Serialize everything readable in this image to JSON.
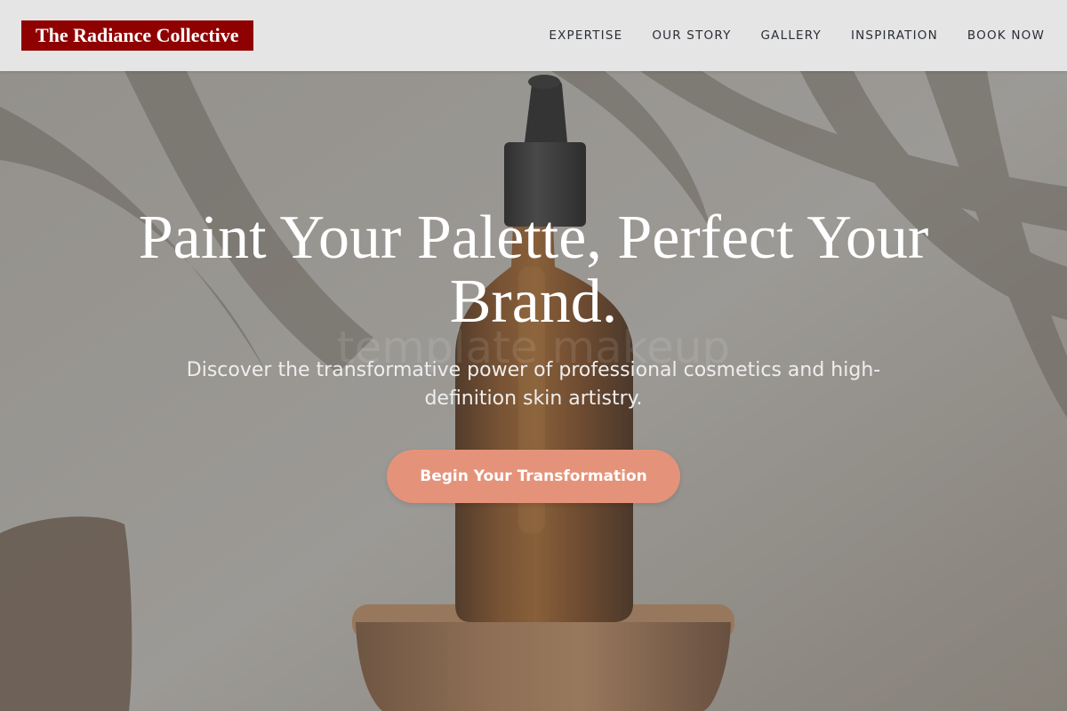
{
  "brand": {
    "name": "The Radiance Collective",
    "badge_color": "#8f0000"
  },
  "nav": {
    "items": [
      {
        "label": "EXPERTISE"
      },
      {
        "label": "OUR STORY"
      },
      {
        "label": "GALLERY"
      },
      {
        "label": "INSPIRATION"
      },
      {
        "label": "BOOK NOW"
      }
    ]
  },
  "hero": {
    "title": "Paint Your Palette, Perfect Your Brand.",
    "subtitle": "Discover the transformative power of professional cosmetics and high-definition skin artistry.",
    "watermark": "template makeup",
    "cta_label": "Begin Your Transformation",
    "cta_color": "#e4937a",
    "background_image": "amber-dropper-bottle-on-wooden-pedestal"
  }
}
